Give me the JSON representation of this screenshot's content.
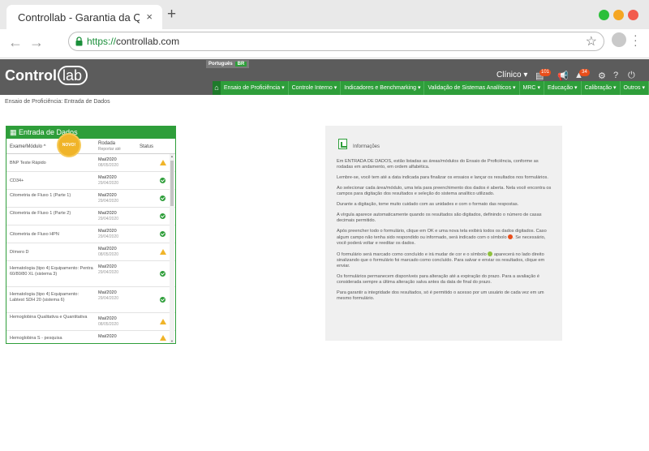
{
  "browser": {
    "tab_title": "Controllab - Garantia da Qualid",
    "tab_close": "×",
    "new_tab": "+",
    "url_protocol": "https://",
    "url_host": "controllab.com",
    "back": "←",
    "forward": "→",
    "star": "☆",
    "window_dots": [
      "#2cbf3a",
      "#f5a623",
      "#f25b4d"
    ]
  },
  "header": {
    "logo_main": "Control",
    "logo_lab": "lab",
    "lang_label": "Português",
    "lang_code": "BR",
    "clinic": "Clínico",
    "badge_notifications": "101",
    "badge_alerts": "34"
  },
  "nav": {
    "home_icon": "home-icon",
    "items": [
      "Ensaio de Proficiência",
      "Controle Interno",
      "Indicadores e Benchmarking",
      "Validação de Sistemas Analíticos",
      "MRC",
      "Educação",
      "Calibração",
      "Outros"
    ]
  },
  "breadcrumb": "Ensaio de Proficiência: Entrada de Dados",
  "panel": {
    "title": "Entrada de Dados",
    "col_exam": "Exame/Módulo ^",
    "col_round": "Rodada",
    "col_report": "Reportar até",
    "col_status": "Status",
    "novo_badge": "NOVO!",
    "rows": [
      {
        "exam": "BNP Teste Rápido",
        "round": "Mai/2020",
        "report": "08/05/2020",
        "status": "warning"
      },
      {
        "exam": "CD34+",
        "round": "Mai/2020",
        "report": "29/04/2020",
        "status": "ok"
      },
      {
        "exam": "Citometria de Fluxo 1 (Parte 1)",
        "round": "Mai/2020",
        "report": "29/04/2020",
        "status": "ok"
      },
      {
        "exam": "Citometria de Fluxo 1 (Parte 2)",
        "round": "Mai/2020",
        "report": "29/04/2020",
        "status": "ok"
      },
      {
        "exam": "Citometria de Fluxo HPN",
        "round": "Mai/2020",
        "report": "29/04/2020",
        "status": "ok"
      },
      {
        "exam": "Dímero D",
        "round": "Mai/2020",
        "report": "08/05/2020",
        "status": "warning"
      },
      {
        "exam": "Hematologia (tipo 4) Equipamento: Pentra 60/80/80 XL (sistema 3)",
        "round": "Mai/2020",
        "report": "29/04/2020",
        "status": "ok"
      },
      {
        "exam": "Hematologia (tipo 4) Equipamento: Labtest SDH 20 (sistema 6)",
        "round": "Mai/2020",
        "report": "29/04/2020",
        "status": "ok"
      },
      {
        "exam": "Hemoglobina Qualitativa e Quantitativa",
        "round": "Mai/2020",
        "report": "08/05/2020",
        "status": "warning"
      },
      {
        "exam": "Hemoglobina S - pesquisa",
        "round": "Mai/2020",
        "report": "",
        "status": "warning"
      }
    ]
  },
  "info": {
    "title": "Informações",
    "paragraphs": [
      "Em ENTRADA DE DADOS, estão listadas as áreas/módulos do Ensaio de Proficiência, conforme as rodadas em andamento, em ordem alfabética.",
      "Lembre-se, você tem até a data indicada para finalizar os ensaios e lançar os resultados nos formulários.",
      "Ao selecionar cada área/módulo, uma tela para preenchimento dos dados é aberta. Nela você encontra os campos para digitação dos resultados e seleção do sistema analítico utilizado.",
      "Durante a digitação, tome muito cuidado com as unidades e com o formato das respostas.",
      "A vírgula aparece automaticamente quando os resultados são digitados, definindo o número de casas decimais permitido.",
      "Após preencher todo o formulário, clique em OK e uma nova tela exibirá todos os dados digitados. Caso algum campo não tenha sido respondido ou informado, será indicado com o símbolo",
      ". Se necessário, você poderá voltar e reeditar os dados.",
      "O formulário será marcado como concluído e irá mudar de cor e o símbolo",
      "aparecerá no lado direito sinalizando que o formulário foi marcado como concluído. Para salvar e enviar os resultados, clique em enviar.",
      "Os formulários permanecem disponíveis para alteração até a expiração do prazo. Para a avaliação é considerada sempre a última alteração salva antes da data de final do prazo.",
      "Para garantir a integridade dos resultados, só é permitido o acesso por um usuário de cada vez em um mesmo formulário."
    ]
  }
}
